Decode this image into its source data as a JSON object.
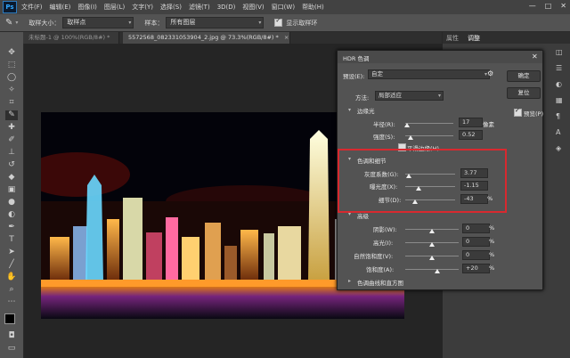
{
  "app": {
    "logo_text": "Ps",
    "menu": [
      "文件(F)",
      "编辑(E)",
      "图像(I)",
      "图层(L)",
      "文字(Y)",
      "选择(S)",
      "滤镜(T)",
      "3D(D)",
      "视图(V)",
      "窗口(W)",
      "帮助(H)"
    ],
    "window_controls": [
      "—",
      "□",
      "✕"
    ]
  },
  "options_bar": {
    "sample_size_label": "取样大小：",
    "sample_size_value": "取样点",
    "sample_label": "样本：",
    "sample_value": "所有图层",
    "show_ring_label": "显示取样环"
  },
  "tabs": [
    {
      "label": "未标题-1 @ 100%(RGB/8#) *",
      "active": false
    },
    {
      "label": "5572568_082331053904_2.jpg @ 73.3%(RGB/8#) *",
      "active": true
    }
  ],
  "right_panel": {
    "tabs": [
      "属性",
      "调整"
    ]
  },
  "dialog": {
    "title": "HDR 色调",
    "preset_label": "预设(E):",
    "preset_value": "自定",
    "method_label": "方法:",
    "method_value": "局部适应",
    "ok_label": "确定",
    "reset_label": "复位",
    "preview_label": "预览(P)",
    "edge_glow": {
      "section_label": "边缘光",
      "radius_label": "半径(R):",
      "radius_value": "17",
      "radius_unit": "像素",
      "radius_level": 0.03,
      "strength_label": "强度(S):",
      "strength_value": "0.52",
      "strength_level": 0.12,
      "smooth_edges_label": "平滑边缘(H)"
    },
    "tone_detail": {
      "section_label": "色调和细节",
      "gamma_label": "灰度系数(G):",
      "gamma_value": "3.77",
      "gamma_level": 0.07,
      "exposure_label": "曝光度(X):",
      "exposure_value": "-1.15",
      "exposure_level": 0.27,
      "detail_label": "细节(D):",
      "detail_value": "-43",
      "detail_unit": "%",
      "detail_level": 0.2
    },
    "advanced": {
      "section_label": "高级",
      "shadow_label": "阴影(W):",
      "shadow_value": "0",
      "highlight_label": "高光(I):",
      "highlight_value": "0",
      "vibrance_label": "自然饱和度(V):",
      "vibrance_value": "0",
      "saturation_label": "饱和度(A):",
      "saturation_value": "+20",
      "unit": "%"
    },
    "curve_section_label": "色调曲线和直方图"
  },
  "colors": {
    "accent_highlight": "#d8292f"
  }
}
